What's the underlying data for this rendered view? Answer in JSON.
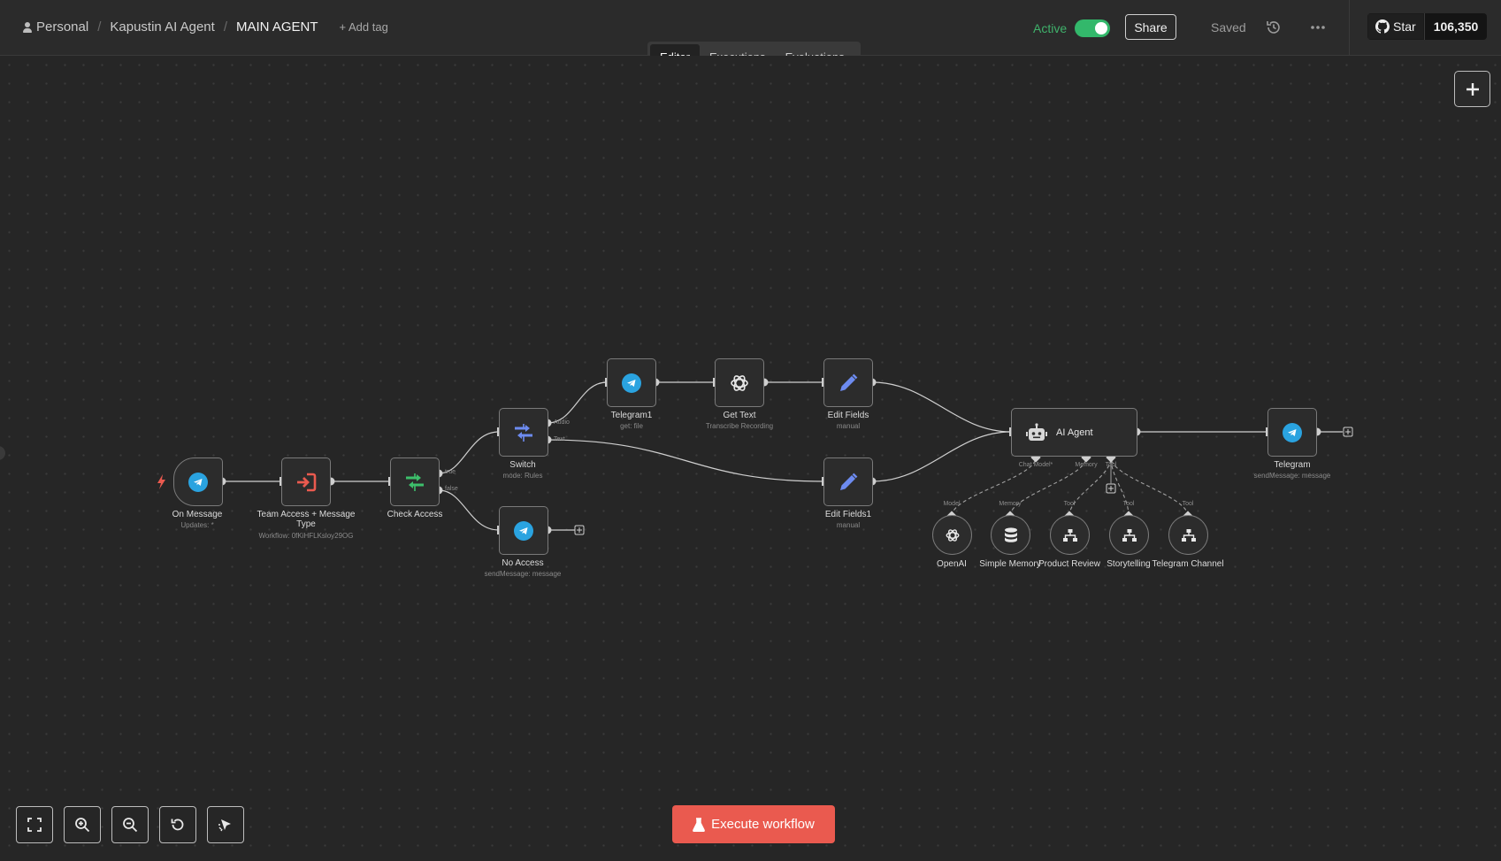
{
  "header": {
    "breadcrumb": {
      "personal": "Personal",
      "project": "Kapustin AI Agent",
      "workflow": "MAIN AGENT"
    },
    "add_tag": "+ Add tag",
    "active_label": "Active",
    "active": true,
    "share": "Share",
    "saved": "Saved",
    "github": {
      "star": "Star",
      "count": "106,350"
    }
  },
  "tabs": [
    {
      "label": "Editor",
      "active": true
    },
    {
      "label": "Executions"
    },
    {
      "label": "Evaluations"
    }
  ],
  "nodes": {
    "on_message": {
      "label": "On Message",
      "sub": "Updates: *",
      "icon": "telegram-icon"
    },
    "team_access": {
      "label1": "Team Access + Message",
      "label2": "Type",
      "sub": "Workflow: 0fKiHFLKsloy29OG",
      "icon": "execute-workflow-icon"
    },
    "check_access": {
      "label": "Check Access",
      "icon": "if-icon",
      "out_true": "true",
      "out_false": "false"
    },
    "switch": {
      "label": "Switch",
      "sub": "mode: Rules",
      "icon": "switch-icon",
      "out_audio": "Audio",
      "out_text": "Text"
    },
    "no_access": {
      "label": "No Access",
      "sub": "sendMessage: message",
      "icon": "telegram-icon"
    },
    "telegram1": {
      "label": "Telegram1",
      "sub": "get: file",
      "icon": "telegram-icon"
    },
    "get_text": {
      "label": "Get Text",
      "sub": "Transcribe Recording",
      "icon": "openai-icon"
    },
    "edit_fields": {
      "label": "Edit Fields",
      "sub": "manual",
      "icon": "pencil-icon"
    },
    "edit_fields1": {
      "label": "Edit Fields1",
      "sub": "manual",
      "icon": "pencil-icon"
    },
    "ai_agent": {
      "label": "AI Agent",
      "icon": "robot-icon",
      "in_chat": "Chat Model*",
      "in_memory": "Memory",
      "in_tool": "Tool"
    },
    "telegram": {
      "label": "Telegram",
      "sub": "sendMessage: message",
      "icon": "telegram-icon"
    },
    "openai": {
      "label": "OpenAI",
      "conn": "Model",
      "icon": "openai-icon"
    },
    "simple_memory": {
      "label": "Simple Memory",
      "conn": "Memory",
      "icon": "database-icon"
    },
    "product_review": {
      "label": "Product Review",
      "conn": "Tool",
      "icon": "workflow-tool-icon"
    },
    "storytelling": {
      "label": "Storytelling",
      "conn": "Tool",
      "icon": "workflow-tool-icon"
    },
    "telegram_channel": {
      "label": "Telegram Channel",
      "conn": "Tool",
      "icon": "workflow-tool-icon"
    }
  },
  "controls": {
    "buttons": [
      "fit-view-icon",
      "zoom-in-icon",
      "zoom-out-icon",
      "reset-zoom-icon",
      "tidy-up-icon"
    ],
    "execute": "Execute workflow"
  },
  "colors": {
    "accent": "#ea5a4f",
    "active": "#33b86b",
    "telegram": "#2aa3e0",
    "if_node": "#3dbf6b",
    "switch_node": "#6d8bf0",
    "edit_node": "#6d8bf0",
    "execute_node": "#ea5a4f"
  }
}
